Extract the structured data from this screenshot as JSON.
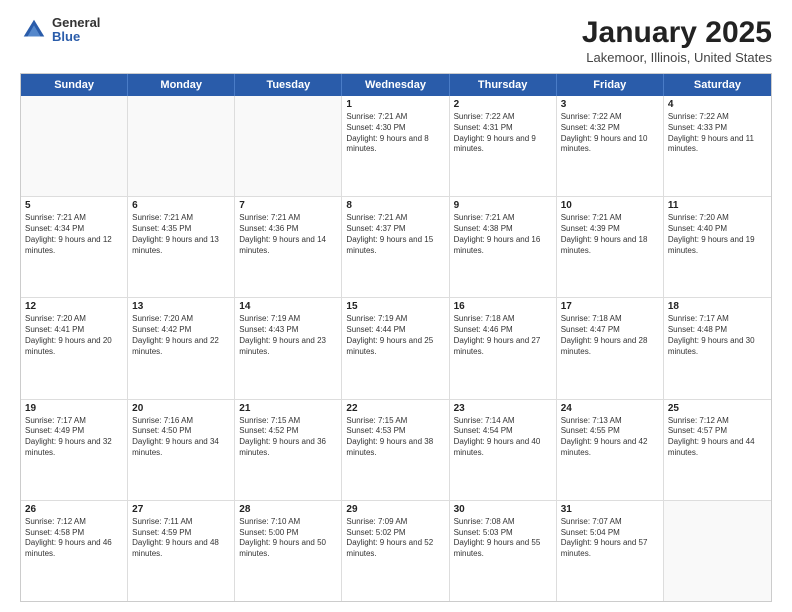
{
  "logo": {
    "general": "General",
    "blue": "Blue"
  },
  "header": {
    "title": "January 2025",
    "subtitle": "Lakemoor, Illinois, United States"
  },
  "days_of_week": [
    "Sunday",
    "Monday",
    "Tuesday",
    "Wednesday",
    "Thursday",
    "Friday",
    "Saturday"
  ],
  "weeks": [
    [
      {
        "day": "",
        "text": "",
        "empty": true
      },
      {
        "day": "",
        "text": "",
        "empty": true
      },
      {
        "day": "",
        "text": "",
        "empty": true
      },
      {
        "day": "1",
        "text": "Sunrise: 7:21 AM\nSunset: 4:30 PM\nDaylight: 9 hours and 8 minutes."
      },
      {
        "day": "2",
        "text": "Sunrise: 7:22 AM\nSunset: 4:31 PM\nDaylight: 9 hours and 9 minutes."
      },
      {
        "day": "3",
        "text": "Sunrise: 7:22 AM\nSunset: 4:32 PM\nDaylight: 9 hours and 10 minutes."
      },
      {
        "day": "4",
        "text": "Sunrise: 7:22 AM\nSunset: 4:33 PM\nDaylight: 9 hours and 11 minutes."
      }
    ],
    [
      {
        "day": "5",
        "text": "Sunrise: 7:21 AM\nSunset: 4:34 PM\nDaylight: 9 hours and 12 minutes."
      },
      {
        "day": "6",
        "text": "Sunrise: 7:21 AM\nSunset: 4:35 PM\nDaylight: 9 hours and 13 minutes."
      },
      {
        "day": "7",
        "text": "Sunrise: 7:21 AM\nSunset: 4:36 PM\nDaylight: 9 hours and 14 minutes."
      },
      {
        "day": "8",
        "text": "Sunrise: 7:21 AM\nSunset: 4:37 PM\nDaylight: 9 hours and 15 minutes."
      },
      {
        "day": "9",
        "text": "Sunrise: 7:21 AM\nSunset: 4:38 PM\nDaylight: 9 hours and 16 minutes."
      },
      {
        "day": "10",
        "text": "Sunrise: 7:21 AM\nSunset: 4:39 PM\nDaylight: 9 hours and 18 minutes."
      },
      {
        "day": "11",
        "text": "Sunrise: 7:20 AM\nSunset: 4:40 PM\nDaylight: 9 hours and 19 minutes."
      }
    ],
    [
      {
        "day": "12",
        "text": "Sunrise: 7:20 AM\nSunset: 4:41 PM\nDaylight: 9 hours and 20 minutes."
      },
      {
        "day": "13",
        "text": "Sunrise: 7:20 AM\nSunset: 4:42 PM\nDaylight: 9 hours and 22 minutes."
      },
      {
        "day": "14",
        "text": "Sunrise: 7:19 AM\nSunset: 4:43 PM\nDaylight: 9 hours and 23 minutes."
      },
      {
        "day": "15",
        "text": "Sunrise: 7:19 AM\nSunset: 4:44 PM\nDaylight: 9 hours and 25 minutes."
      },
      {
        "day": "16",
        "text": "Sunrise: 7:18 AM\nSunset: 4:46 PM\nDaylight: 9 hours and 27 minutes."
      },
      {
        "day": "17",
        "text": "Sunrise: 7:18 AM\nSunset: 4:47 PM\nDaylight: 9 hours and 28 minutes."
      },
      {
        "day": "18",
        "text": "Sunrise: 7:17 AM\nSunset: 4:48 PM\nDaylight: 9 hours and 30 minutes."
      }
    ],
    [
      {
        "day": "19",
        "text": "Sunrise: 7:17 AM\nSunset: 4:49 PM\nDaylight: 9 hours and 32 minutes."
      },
      {
        "day": "20",
        "text": "Sunrise: 7:16 AM\nSunset: 4:50 PM\nDaylight: 9 hours and 34 minutes."
      },
      {
        "day": "21",
        "text": "Sunrise: 7:15 AM\nSunset: 4:52 PM\nDaylight: 9 hours and 36 minutes."
      },
      {
        "day": "22",
        "text": "Sunrise: 7:15 AM\nSunset: 4:53 PM\nDaylight: 9 hours and 38 minutes."
      },
      {
        "day": "23",
        "text": "Sunrise: 7:14 AM\nSunset: 4:54 PM\nDaylight: 9 hours and 40 minutes."
      },
      {
        "day": "24",
        "text": "Sunrise: 7:13 AM\nSunset: 4:55 PM\nDaylight: 9 hours and 42 minutes."
      },
      {
        "day": "25",
        "text": "Sunrise: 7:12 AM\nSunset: 4:57 PM\nDaylight: 9 hours and 44 minutes."
      }
    ],
    [
      {
        "day": "26",
        "text": "Sunrise: 7:12 AM\nSunset: 4:58 PM\nDaylight: 9 hours and 46 minutes."
      },
      {
        "day": "27",
        "text": "Sunrise: 7:11 AM\nSunset: 4:59 PM\nDaylight: 9 hours and 48 minutes."
      },
      {
        "day": "28",
        "text": "Sunrise: 7:10 AM\nSunset: 5:00 PM\nDaylight: 9 hours and 50 minutes."
      },
      {
        "day": "29",
        "text": "Sunrise: 7:09 AM\nSunset: 5:02 PM\nDaylight: 9 hours and 52 minutes."
      },
      {
        "day": "30",
        "text": "Sunrise: 7:08 AM\nSunset: 5:03 PM\nDaylight: 9 hours and 55 minutes."
      },
      {
        "day": "31",
        "text": "Sunrise: 7:07 AM\nSunset: 5:04 PM\nDaylight: 9 hours and 57 minutes."
      },
      {
        "day": "",
        "text": "",
        "empty": true
      }
    ]
  ]
}
